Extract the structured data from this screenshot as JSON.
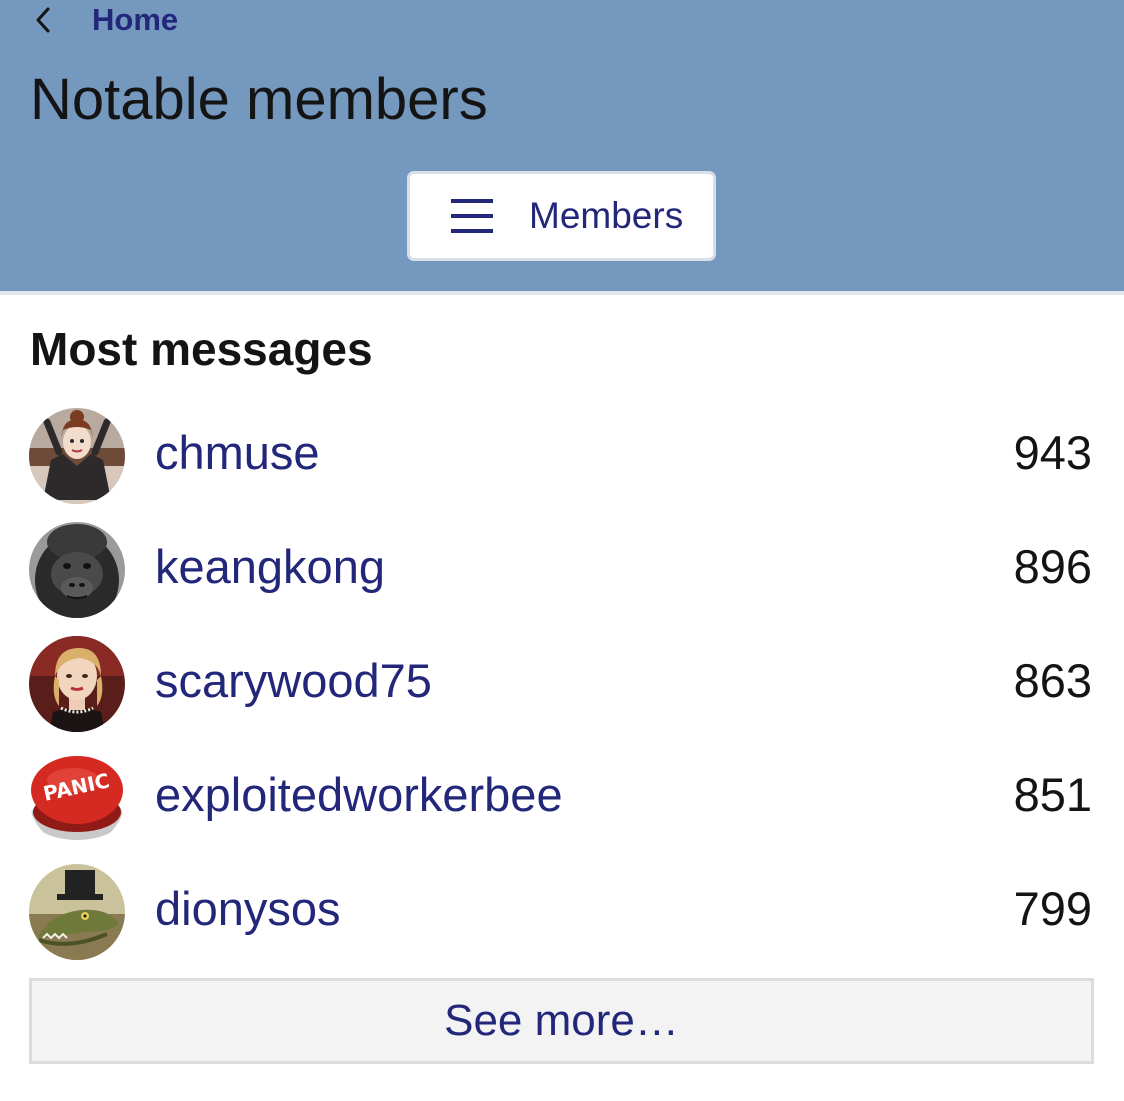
{
  "header": {
    "back_label": "Home",
    "title": "Notable members",
    "members_button_label": "Members"
  },
  "section": {
    "title": "Most messages"
  },
  "members": [
    {
      "name": "chmuse",
      "count": "943"
    },
    {
      "name": "keangkong",
      "count": "896"
    },
    {
      "name": "scarywood75",
      "count": "863"
    },
    {
      "name": "exploitedworkerbee",
      "count": "851"
    },
    {
      "name": "dionysos",
      "count": "799"
    }
  ],
  "avatar_badge_text": "PANIC",
  "see_more_label": "See more…",
  "colors": {
    "header_bg": "#7598bf",
    "link": "#22277a",
    "text": "#141414",
    "button_border": "#d8dfe8",
    "see_more_bg": "#f3f3f3"
  },
  "icons": {
    "back": "chevron-left-icon",
    "menu": "hamburger-menu-icon"
  }
}
